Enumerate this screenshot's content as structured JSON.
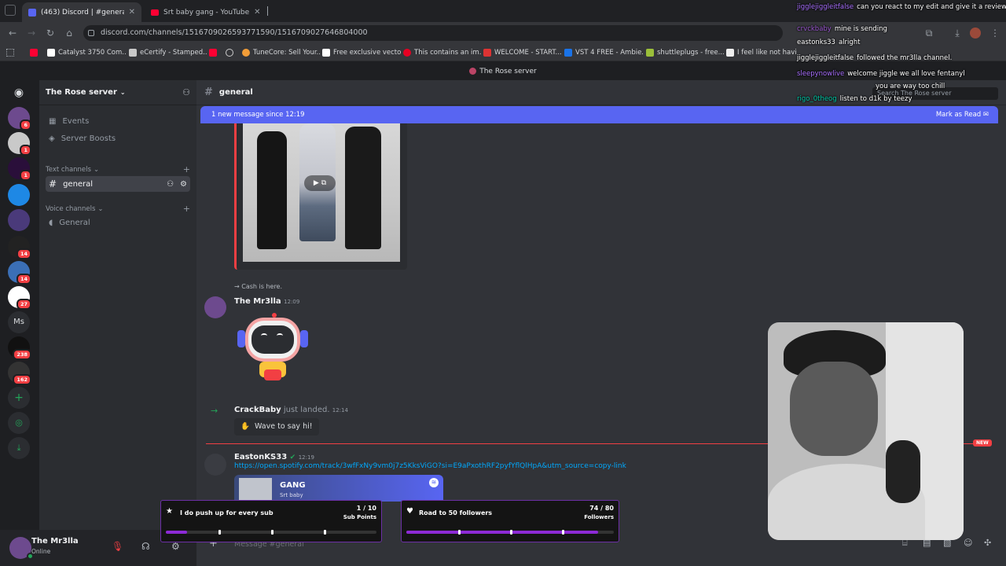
{
  "browser": {
    "tabs": [
      {
        "label": "(463) Discord | #general | The R..."
      },
      {
        "label": "Srt baby gang - YouTube"
      }
    ],
    "url": "discord.com/channels/1516709026593771590/1516709027646804000",
    "bookmarks": [
      "Catalyst 3750 Com...",
      "eCertify - Stamped...",
      "TuneCore: Sell Your...",
      "Free exclusive vecto...",
      "This contains an im...",
      "WELCOME - START...",
      "VST 4 FREE - Ambie...",
      "shuttleplugs - free...",
      "I feel like not having"
    ]
  },
  "server": {
    "title_bar": "The Rose server",
    "name": "The Rose server",
    "events": "Events",
    "boosts": "Server Boosts",
    "text_category": "Text channels",
    "voice_category": "Voice channels",
    "text_channel": "general",
    "voice_channel": "General",
    "search_placeholder": "Search The Rose server"
  },
  "guild_badges": [
    "6",
    "1",
    "1",
    "14",
    "14",
    "27",
    "238",
    "162"
  ],
  "guild_ms": "Ms",
  "user": {
    "name": "The Mr3lla",
    "status": "Online"
  },
  "channel": {
    "name": "general",
    "new_banner": "1 new message since 12:19",
    "mark_read": "Mark as Read",
    "composer_placeholder": "Message #general"
  },
  "messages": {
    "reply_text": "Cash is here.",
    "m1_author": "The Mr3lla",
    "m1_time": "12:09",
    "join_author": "CrackBaby",
    "join_text": "just landed.",
    "join_time": "12:14",
    "wave": "Wave to say hi!",
    "m2_author": "EastonKS33",
    "m2_time": "12:19",
    "m2_link": "https://open.spotify.com/track/3wfFxNy9vm0j7z5KksViGO?si=E9aPxothRF2pyfYflQlHpA&utm_source=copy-link",
    "embed_title": "GANG",
    "embed_sub": "Srt baby",
    "new_label": "NEW"
  },
  "chat_overlay": [
    {
      "user": "jigglejiggleitfalse",
      "text": "can you react to my edit and give it a review"
    },
    {
      "user": "crvckbaby",
      "text": "mine is sending"
    },
    {
      "user": "eastonks33",
      "text": "alright"
    },
    {
      "user": "jigglejiggleitfalse",
      "text": "followed the mr3lla channel."
    },
    {
      "user": "sleepynowlive",
      "text": "welcome jiggle we all love fentanyl"
    },
    {
      "user": "",
      "text": "you are way too chill"
    },
    {
      "user": "rigo_0theog",
      "text": "listen to d1k by teezy"
    }
  ],
  "goals": [
    {
      "title": "I do push up for every sub",
      "count": "1 / 10",
      "unit": "Sub Points",
      "progress": 0.1
    },
    {
      "title": "Road to 50 followers",
      "count": "74 / 80",
      "unit": "Followers",
      "progress": 0.925
    }
  ],
  "colors": {
    "accent": "#5865f2",
    "online": "#23a559",
    "badge": "#f23f43",
    "goal": "#8d2ad6"
  }
}
